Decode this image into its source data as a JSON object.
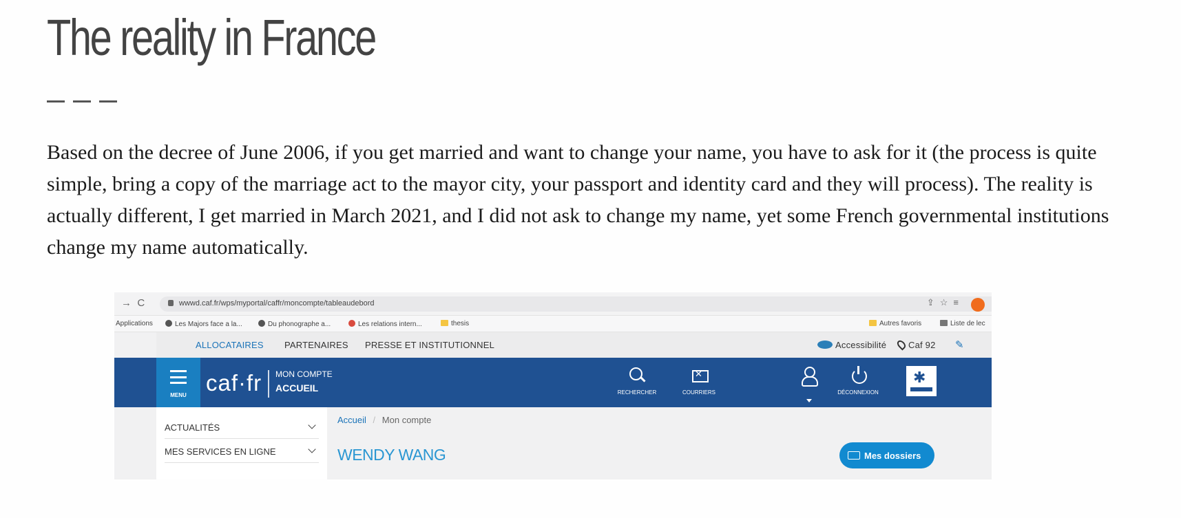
{
  "slide": {
    "title": "The reality in France",
    "body": "Based on the decree of June 2006, if you get married and want to change your name, you have to ask for it (the process is quite simple, bring a copy of the marriage act to the mayor city, your passport and identity card and they will process). The reality is actually different, I get married in March 2021, and I did not ask to change my name, yet some French governmental institutions change my name automatically."
  },
  "screenshot": {
    "browser": {
      "url": "wwwd.caf.fr/wps/myportal/caffr/moncompte/tableaudebord",
      "bookmarks": [
        "Applications",
        "Les Majors face a la...",
        "Du phonographe a...",
        "Les relations intern...",
        "thesis"
      ],
      "bookmarks_right": [
        "Autres favoris",
        "Liste de lec"
      ]
    },
    "site": {
      "top_nav": [
        "ALLOCATAIRES",
        "PARTENAIRES",
        "PRESSE ET INSTITUTIONNEL"
      ],
      "accessibility": "Accessibilité",
      "caf_dept": "Caf 92",
      "menu_label": "MENU",
      "logo": "caf·fr",
      "logo_line1": "MON COMPTE",
      "logo_line2": "ACCUEIL",
      "tools": [
        "RECHERCHER",
        "COURRIERS",
        "",
        "DÉCONNEXION"
      ],
      "sidebar": [
        "ACTUALITÉS",
        "MES SERVICES EN LIGNE"
      ],
      "breadcrumb": [
        "Accueil",
        "/",
        "Mon compte"
      ],
      "user_name": "WENDY WANG",
      "dossiers_button": "Mes dossiers"
    }
  }
}
